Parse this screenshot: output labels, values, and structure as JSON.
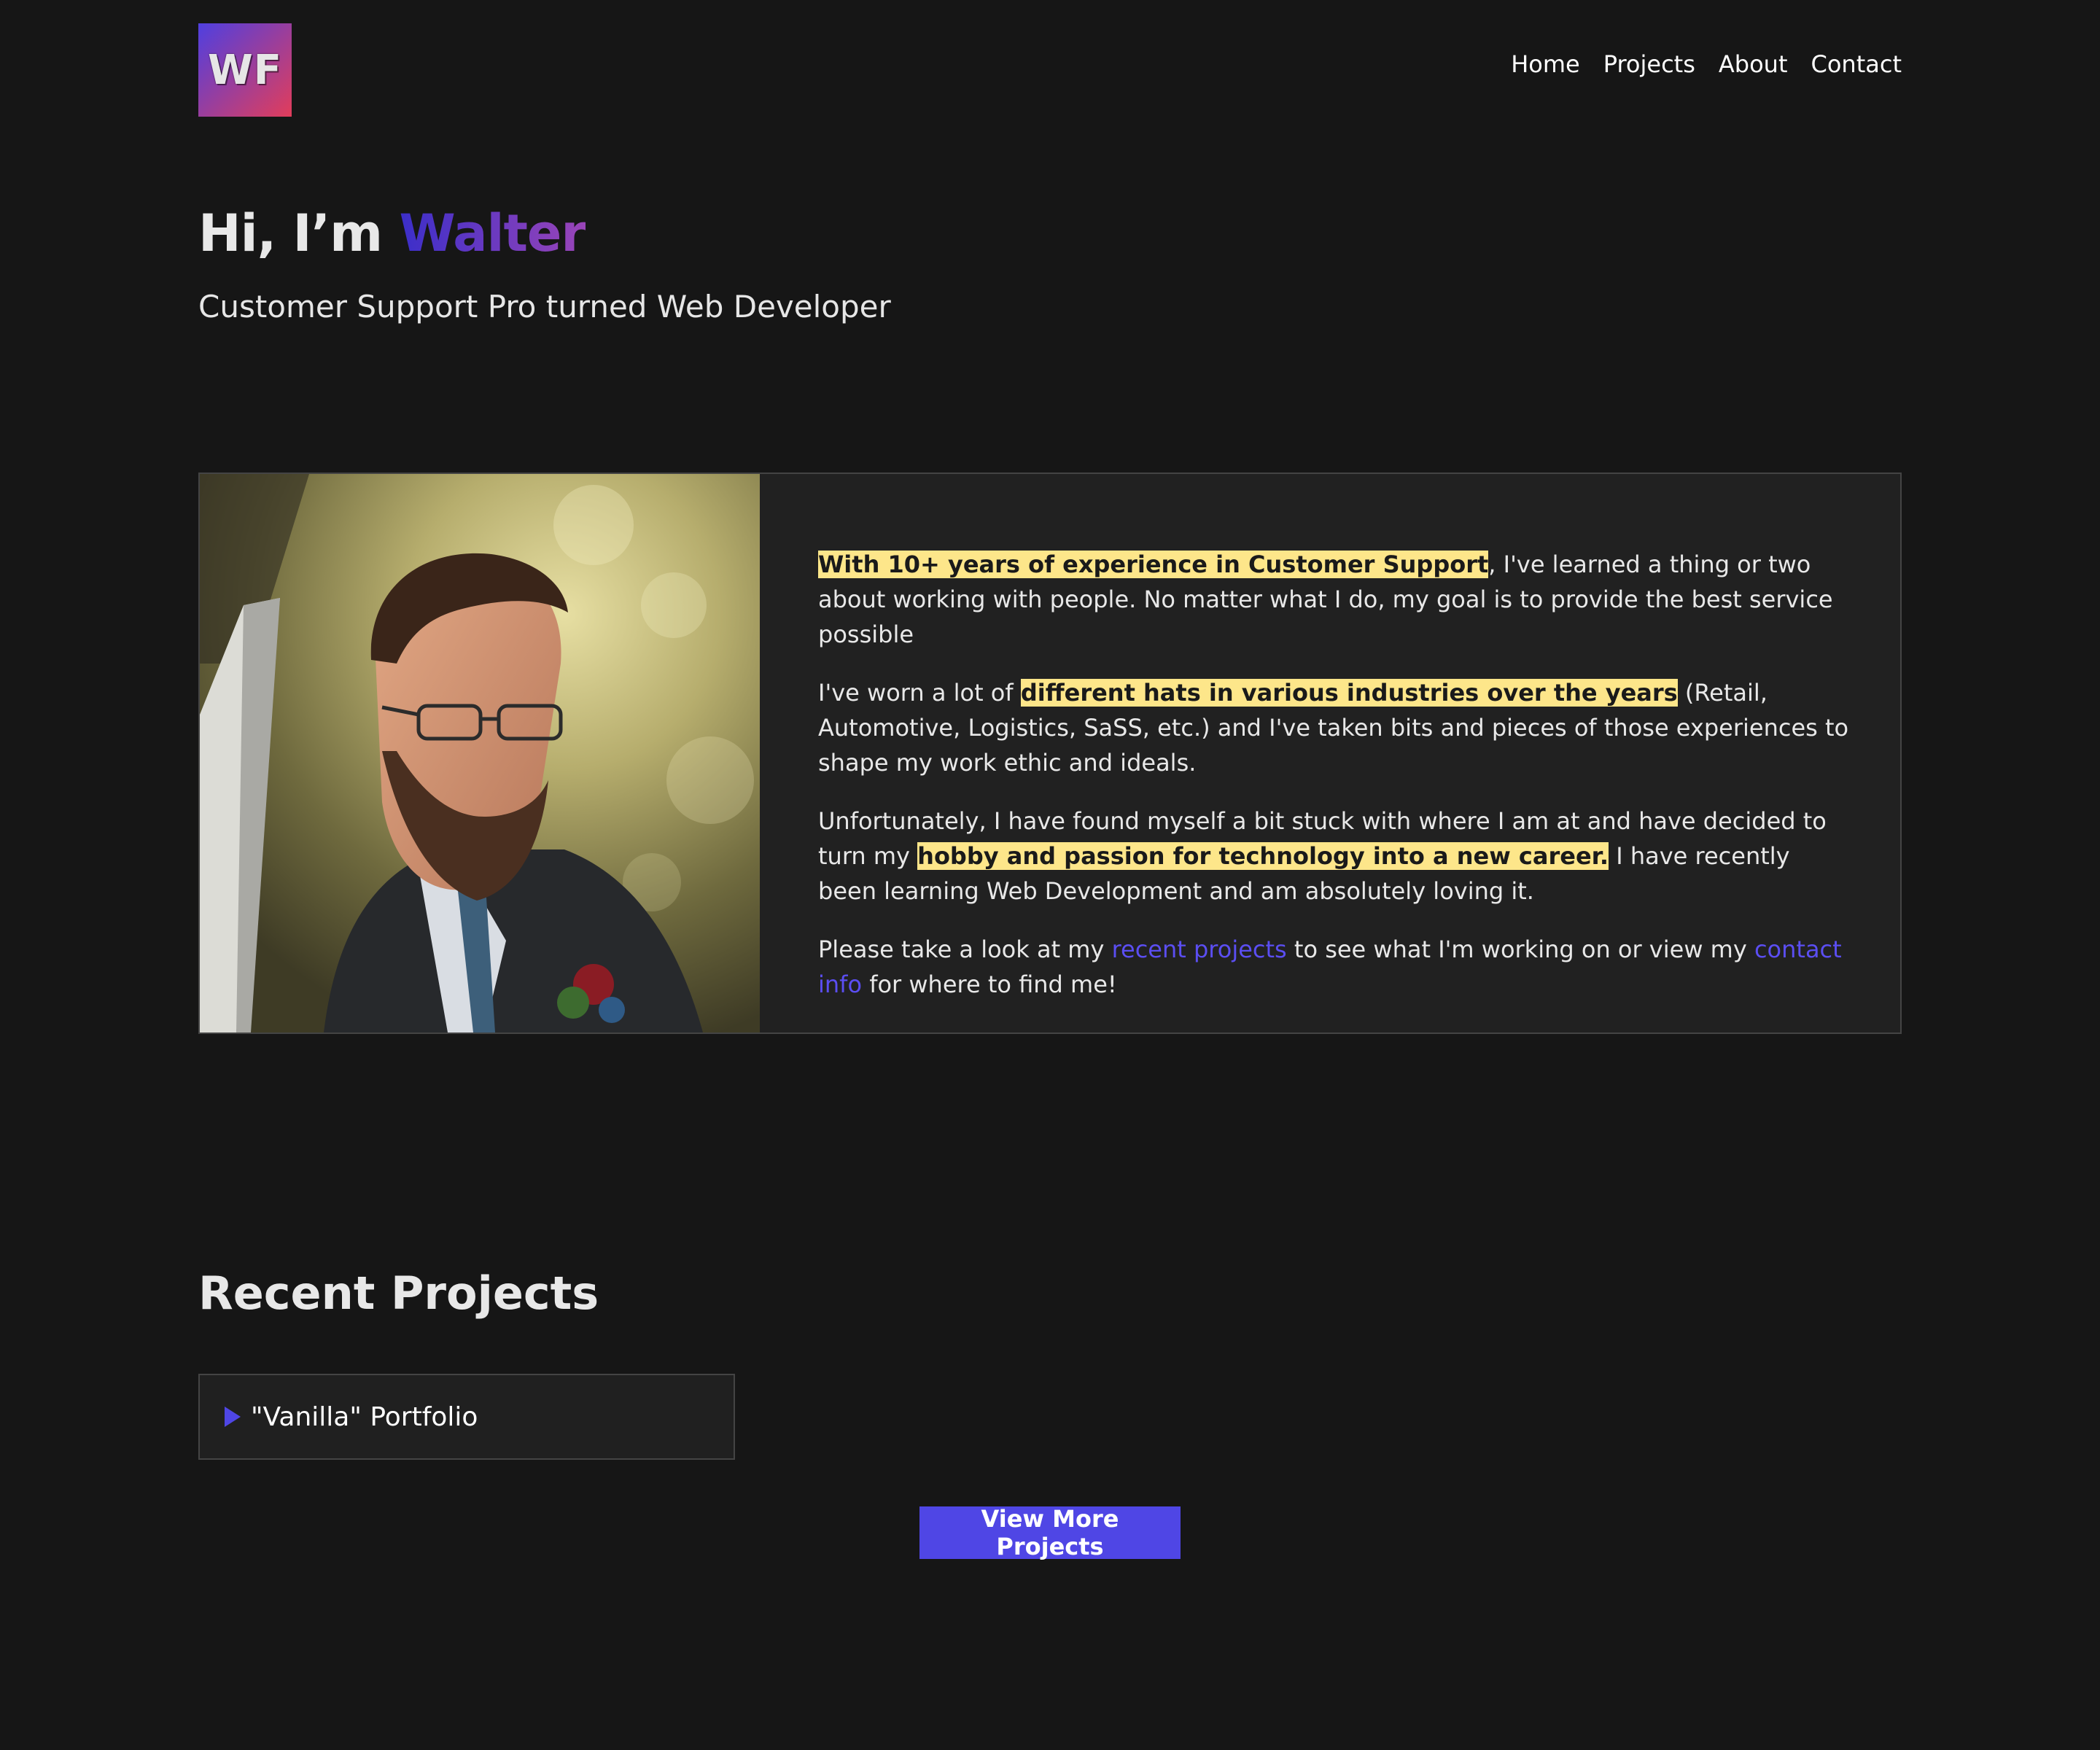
{
  "brand": {
    "logo_text": "WF"
  },
  "nav": {
    "items": [
      {
        "label": "Home"
      },
      {
        "label": "Projects"
      },
      {
        "label": "About"
      },
      {
        "label": "Contact"
      }
    ]
  },
  "hero": {
    "greeting": "Hi, I’m ",
    "name": "Walter",
    "subtitle": "Customer Support Pro turned Web Developer"
  },
  "about": {
    "photo_alt": "Portrait of Walter",
    "p1_highlight": "With 10+ years of experience in Customer Support",
    "p1_rest": ", I've learned a thing or two about working with people. No matter what I do, my goal is to provide the best service possible",
    "p2_pre": "I've worn a lot of ",
    "p2_highlight": "different hats in various industries over the years",
    "p2_rest": " (Retail, Automotive, Logistics, SaSS, etc.) and I've taken bits and pieces of those experiences to shape my work ethic and ideals.",
    "p3_pre": "Unfortunately, I have found myself a bit stuck with where I am at and have decided to turn my ",
    "p3_highlight": "hobby and passion for technology into a new career.",
    "p3_rest": " I have recently been learning Web Development and am absolutely loving it.",
    "p4_pre": "Please take a look at my ",
    "p4_link1": "recent projects",
    "p4_mid": " to see what I'm working on or view my ",
    "p4_link2": "contact info",
    "p4_rest": " for where to find me!"
  },
  "projects": {
    "heading": "Recent Projects",
    "items": [
      {
        "title": "\"Vanilla\" Portfolio"
      }
    ],
    "more_button": "View More Projects"
  },
  "colors": {
    "background": "#161616",
    "card": "#212121",
    "accent": "#4f46e5",
    "highlight": "#fde68a"
  }
}
